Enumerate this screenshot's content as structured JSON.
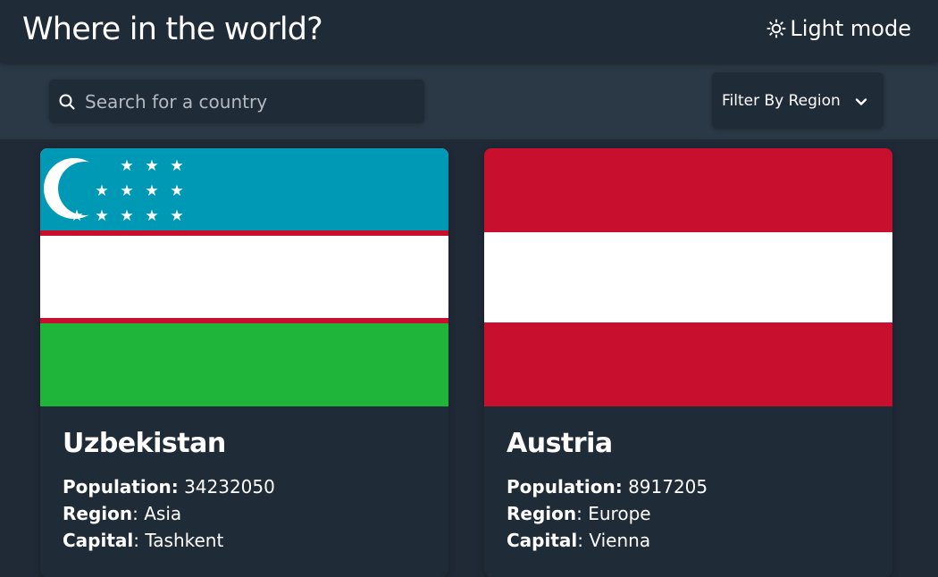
{
  "header": {
    "title": "Where in the world?",
    "theme_toggle_label": "Light mode",
    "theme_icon": "sun-icon"
  },
  "search": {
    "placeholder": "Search for a country",
    "value": "",
    "icon": "search-icon"
  },
  "filter": {
    "label": "Filter By Region",
    "icon": "chevron-down-icon"
  },
  "countries": [
    {
      "name": "Uzbekistan",
      "flag": "flag-uzbekistan",
      "population_label": "Population:",
      "population": "34232050",
      "region_label": "Region",
      "region": "Asia",
      "capital_label": "Capital",
      "capital": "Tashkent"
    },
    {
      "name": "Austria",
      "flag": "flag-austria",
      "population_label": "Population:",
      "population": "8917205",
      "region_label": "Region",
      "region": "Europe",
      "capital_label": "Capital",
      "capital": "Vienna"
    }
  ],
  "colors": {
    "background": "#202a36",
    "element": "#202b38",
    "toolbar": "#2b3845",
    "text": "#ffffff",
    "uzbekistan_blue": "#0099b5",
    "uzbekistan_green": "#1eb53a",
    "flag_red": "#c8102e"
  }
}
